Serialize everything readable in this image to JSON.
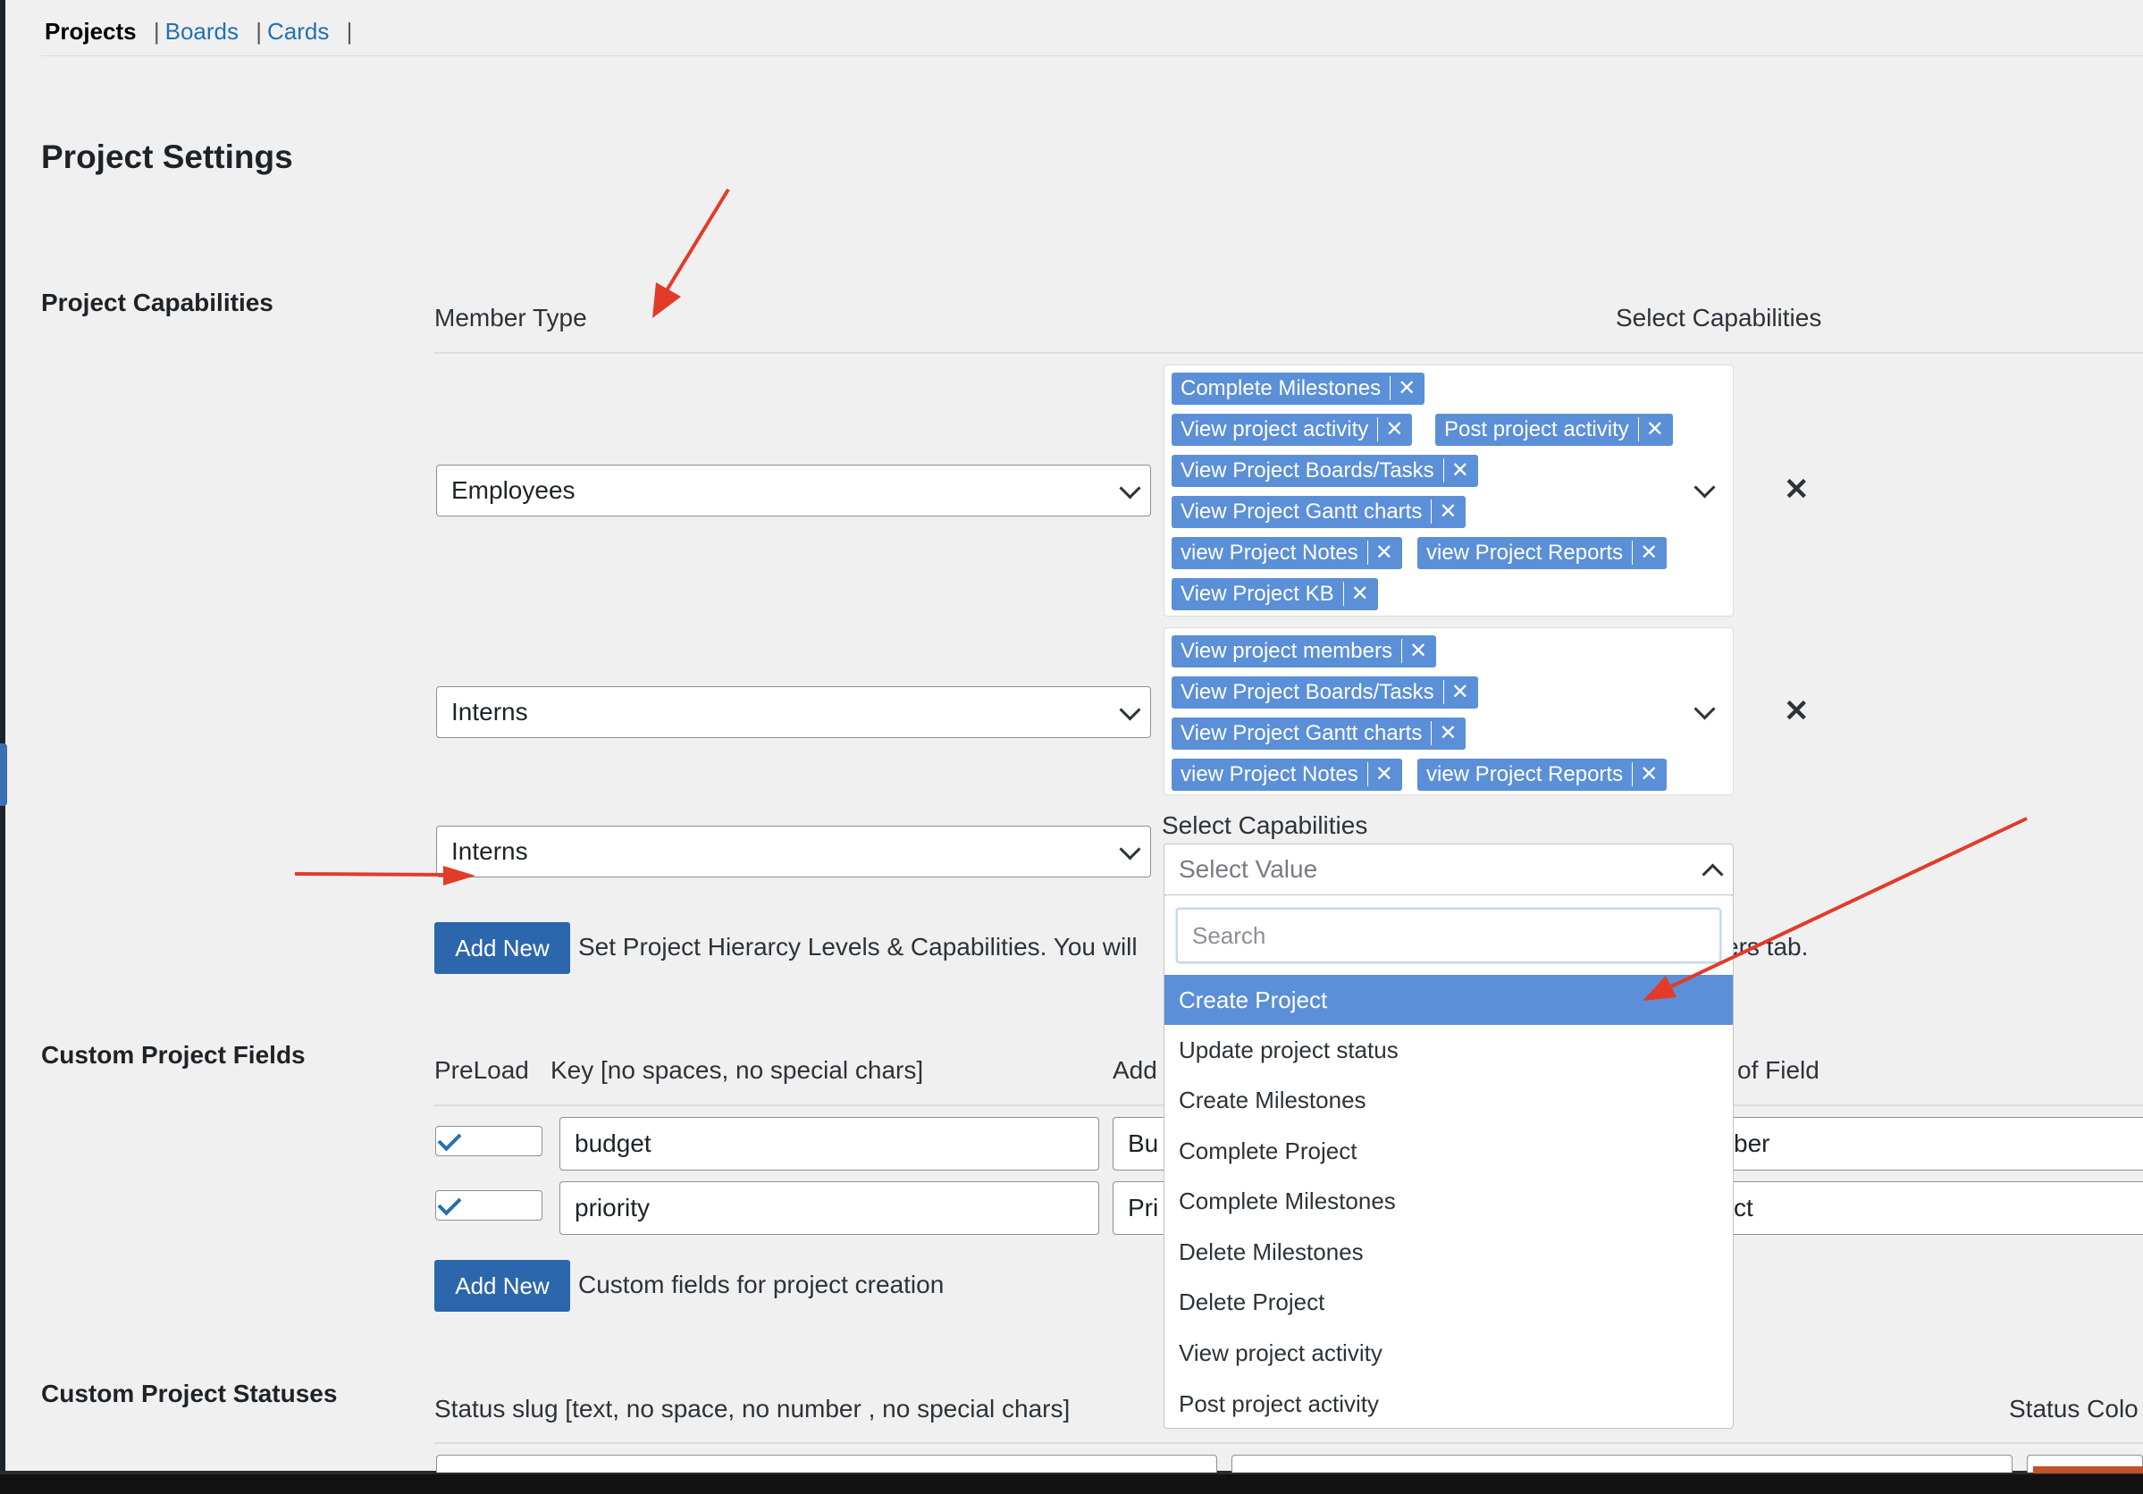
{
  "nav": {
    "current": "Projects",
    "links": [
      "Boards",
      "Cards"
    ],
    "separator": "|"
  },
  "page_title": "Project Settings",
  "capabilities": {
    "section_label": "Project Capabilities",
    "member_type_header": "Member Type",
    "select_capabilities_header": "Select Capabilities",
    "rows": [
      {
        "member_type": "Employees",
        "tags": [
          "Complete Milestones",
          "View project activity",
          "Post project activity",
          "View Project Boards/Tasks",
          "View Project Gantt charts",
          "view Project Notes",
          "view Project Reports",
          "View Project KB"
        ]
      },
      {
        "member_type": "Interns",
        "tags": [
          "View project members",
          "View Project Boards/Tasks",
          "View Project Gantt charts",
          "view Project Notes",
          "view Project Reports"
        ]
      }
    ],
    "new_row": {
      "member_type": "Interns",
      "capabilities_label": "Select Capabilities",
      "placeholder": "Select Value"
    },
    "add_new_label": "Add New",
    "help_text_left": "Set Project Hierarcy Levels & Capabilities. You will",
    "help_text_right": "ers tab."
  },
  "dropdown": {
    "search_placeholder": "Search",
    "highlighted_index": 0,
    "options": [
      "Create Project",
      "Update project status",
      "Create Milestones",
      "Complete Project",
      "Complete Milestones",
      "Delete Milestones",
      "Delete Project",
      "View project activity",
      "Post project activity"
    ]
  },
  "custom_fields": {
    "section_label": "Custom Project Fields",
    "headers": {
      "preload": "PreLoad",
      "key": "Key [no spaces, no special chars]",
      "add_partial": "Add",
      "type_partial": "of Field"
    },
    "rows": [
      {
        "preload": true,
        "key": "budget",
        "label_partial": "Bu",
        "type_partial": "ber"
      },
      {
        "preload": true,
        "key": "priority",
        "label_partial": "Pri",
        "type_partial": "ct"
      }
    ],
    "add_new_label": "Add New",
    "help_text": "Custom fields for project creation"
  },
  "statuses": {
    "section_label": "Custom Project Statuses",
    "slug_header": "Status slug [text, no space, no number , no special chars]",
    "color_header_partial": "Status Colo"
  },
  "colors": {
    "accent": "#2271b1",
    "button": "#2c67ad",
    "tag": "#5b8fd8",
    "annotation_arrow": "#e23b2a"
  }
}
